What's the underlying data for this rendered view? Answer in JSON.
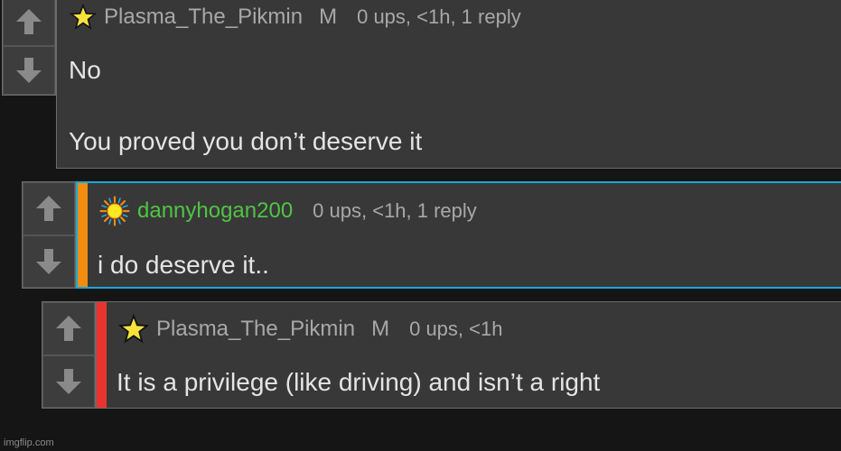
{
  "comments": [
    {
      "username": "Plasma_The_Pikmin",
      "mod_badge": "M",
      "stats": "0 ups, <1h, 1 reply",
      "lines": [
        "No",
        "You proved you don’t deserve it"
      ],
      "badge_icon": "star-icon"
    },
    {
      "username": "dannyhogan200",
      "mod_badge": "",
      "stats": "0 ups, <1h, 1 reply",
      "lines": [
        "i do deserve it.."
      ],
      "badge_icon": "sun-icon",
      "accent_color": "#f28c0f",
      "highlight_color": "#19a9d8"
    },
    {
      "username": "Plasma_The_Pikmin",
      "mod_badge": "M",
      "stats": "0 ups, <1h",
      "lines": [
        "It is a privilege (like driving) and isn’t a right"
      ],
      "badge_icon": "star-icon",
      "accent_color": "#e8332f"
    }
  ],
  "vote_icons": {
    "up": "arrow-up-icon",
    "down": "arrow-down-icon"
  },
  "footer": "imgflip.com"
}
